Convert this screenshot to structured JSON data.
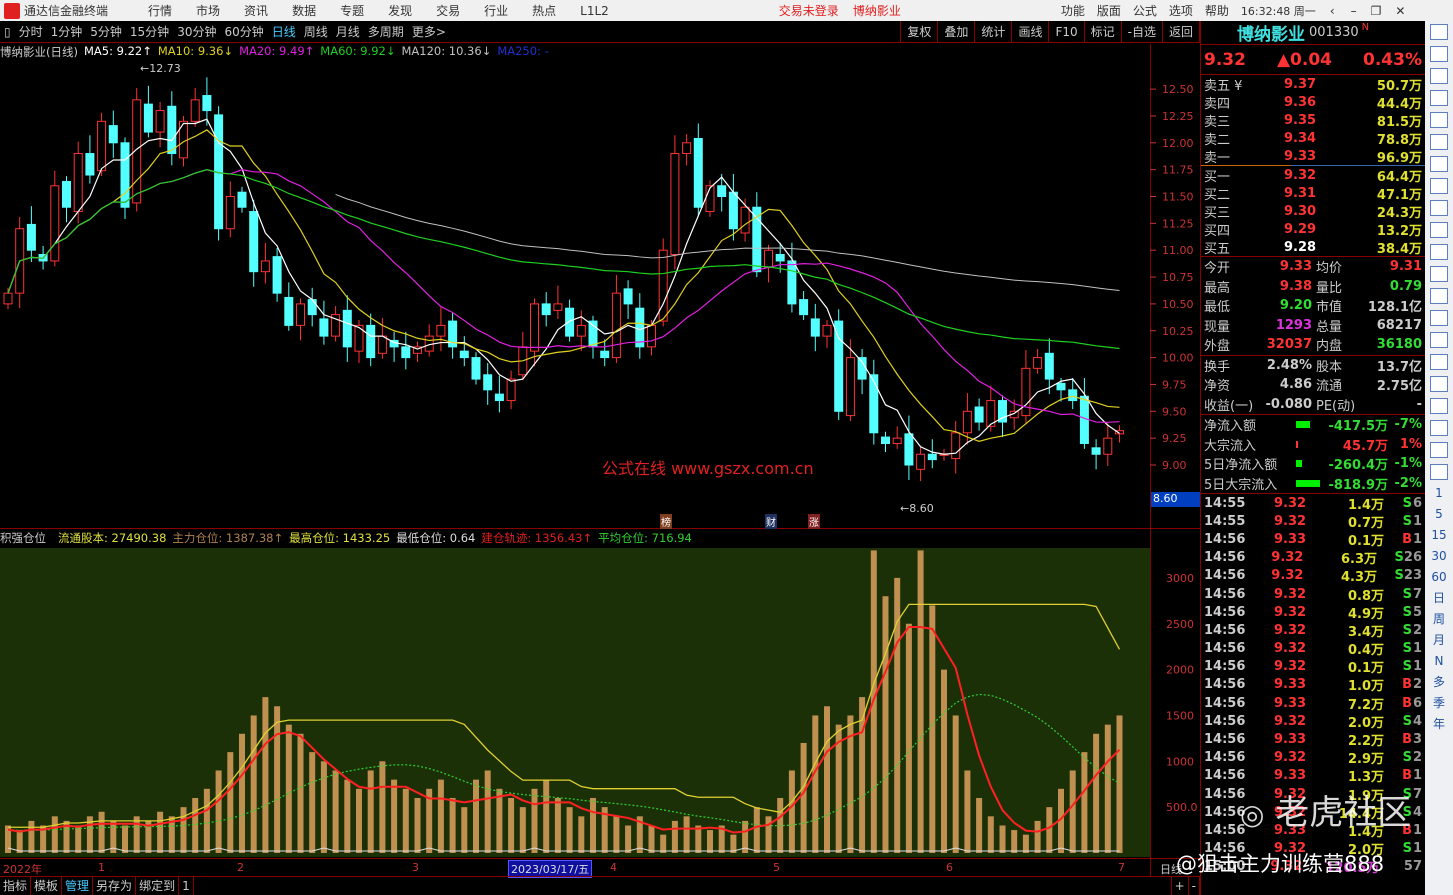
{
  "titlebar": {
    "app": "通达信金融终端",
    "menus": [
      "行情",
      "市场",
      "资讯",
      "数据",
      "专题",
      "发现",
      "交易",
      "行业",
      "热点",
      "L1L2"
    ],
    "login": "交易未登录",
    "stock": "博纳影业",
    "right_menus": [
      "功能",
      "版面",
      "公式",
      "选项",
      "帮助"
    ],
    "clock": "16:32:48 周一"
  },
  "toolbar": {
    "periods": [
      "分时",
      "1分钟",
      "5分钟",
      "15分钟",
      "30分钟",
      "60分钟",
      "日线",
      "周线",
      "月线",
      "多周期",
      "更多>"
    ],
    "selected": "日线",
    "tools": [
      "复权",
      "叠加",
      "统计",
      "画线",
      "F10",
      "标记",
      "-自选",
      "返回"
    ]
  },
  "ma": {
    "title": "博纳影业(日线)",
    "ma5": "MA5: 9.22↑",
    "ma10": "MA10: 9.36↓",
    "ma20": "MA20: 9.49↑",
    "ma60": "MA60: 9.92↓",
    "ma120": "MA120: 10.36↓",
    "ma250": "MA250: -"
  },
  "colors": {
    "up": "#ff3232",
    "down": "#54ffff",
    "ma5": "#ffffff",
    "ma10": "#e0d020",
    "ma20": "#e020e0",
    "ma60": "#20d020",
    "ma120": "#c0c0c0",
    "bar": "#c09050",
    "red_line": "#ff2020",
    "yellow_line": "#e0d030",
    "green_line": "#30d030"
  },
  "labels": {
    "high": "12.73",
    "low": "8.60",
    "cursor_price": "8.60",
    "markers": [
      "榜",
      "财",
      "涨"
    ],
    "watermark1": "公式在线  www.gszx.com.cn",
    "watermark2": "老虎社区",
    "watermark3": "@狙击主力训练营888"
  },
  "chart_data": [
    {
      "type": "candlestick",
      "title": "博纳影业(日线)",
      "ylim": [
        8.5,
        12.9
      ],
      "yticks": [
        "12.50",
        "12.25",
        "12.00",
        "11.75",
        "11.50",
        "11.25",
        "11.00",
        "10.75",
        "10.50",
        "10.25",
        "10.00",
        "9.75",
        "9.50",
        "9.25",
        "9.00"
      ],
      "close": [
        10.6,
        11.2,
        11.0,
        10.9,
        11.6,
        11.4,
        11.9,
        11.7,
        12.2,
        12.0,
        11.4,
        12.4,
        12.1,
        12.3,
        11.9,
        12.2,
        12.4,
        12.3,
        11.2,
        11.5,
        11.4,
        10.8,
        10.9,
        10.6,
        10.3,
        10.5,
        10.4,
        10.2,
        10.4,
        10.1,
        10.3,
        10.0,
        10.2,
        10.1,
        10.0,
        10.1,
        10.2,
        10.3,
        10.1,
        10.0,
        9.8,
        9.7,
        9.6,
        9.8,
        10.1,
        10.5,
        10.4,
        10.5,
        10.2,
        10.3,
        10.1,
        10.0,
        10.6,
        10.5,
        10.1,
        10.3,
        11.0,
        11.9,
        12.0,
        11.4,
        11.6,
        11.5,
        11.2,
        11.4,
        10.8,
        11.0,
        10.9,
        10.5,
        10.4,
        10.2,
        10.3,
        9.5,
        10.0,
        9.8,
        9.3,
        9.2,
        9.25,
        9.0,
        9.1,
        9.05,
        9.1,
        9.3,
        9.5,
        9.4,
        9.6,
        9.4,
        9.5,
        9.9,
        10.0,
        9.8,
        9.7,
        9.6,
        9.2,
        9.1,
        9.25,
        9.32
      ]
    },
    {
      "type": "bar+line",
      "title": "积强仓位",
      "legend": {
        "name": "积强仓位",
        "float": "流通股本: 27490.38",
        "main": "主力仓位: 1387.38↑",
        "max": "最高仓位: 1433.25",
        "min": "最低仓位: 0.64",
        "build": "建仓轨迹: 1356.43↑",
        "avg": "平均仓位: 716.94"
      },
      "yticks": [
        "3000",
        "2500",
        "2000",
        "1500",
        "1000",
        "500.0"
      ],
      "ylim": [
        0,
        3300
      ],
      "bars": [
        300,
        250,
        350,
        300,
        400,
        350,
        300,
        400,
        450,
        350,
        300,
        400,
        350,
        450,
        400,
        500,
        600,
        700,
        900,
        1100,
        1300,
        1500,
        1700,
        1600,
        1400,
        1300,
        1100,
        1000,
        900,
        800,
        700,
        900,
        1000,
        800,
        700,
        600,
        700,
        800,
        600,
        500,
        800,
        900,
        700,
        600,
        500,
        700,
        800,
        600,
        500,
        400,
        600,
        500,
        400,
        300,
        400,
        300,
        200,
        350,
        400,
        300,
        250,
        300,
        200,
        350,
        500,
        400,
        600,
        900,
        1200,
        1500,
        1600,
        1400,
        1500,
        1700,
        3300,
        2800,
        3000,
        2500,
        3300,
        2700,
        2000,
        1500,
        900,
        600,
        400,
        300,
        250,
        200,
        350,
        500,
        700,
        900,
        1100,
        1300,
        1400,
        1500
      ]
    }
  ],
  "xaxis": {
    "labels": [
      "2022年",
      "1",
      "2",
      "3",
      "4",
      "5",
      "6",
      "7"
    ],
    "cursor": "2023/03/17/五",
    "right": "日线"
  },
  "bottom_tabs": [
    "指标",
    "模板",
    "管理",
    "另存为",
    "绑定到",
    "1"
  ],
  "quote": {
    "name": "博纳影业",
    "code": "001330",
    "flag": "N",
    "price": "9.32",
    "change": "▲0.04",
    "pct": "0.43%",
    "asks": [
      [
        "卖五 ¥",
        "9.37",
        "50.7万"
      ],
      [
        "卖四",
        "9.36",
        "44.4万"
      ],
      [
        "卖三",
        "9.35",
        "81.5万"
      ],
      [
        "卖二",
        "9.34",
        "78.8万"
      ],
      [
        "卖一",
        "9.33",
        "96.9万"
      ]
    ],
    "bids": [
      [
        "买一",
        "9.32",
        "64.4万"
      ],
      [
        "买二",
        "9.31",
        "47.1万"
      ],
      [
        "买三",
        "9.30",
        "24.3万"
      ],
      [
        "买四",
        "9.29",
        "13.2万"
      ],
      [
        "买五",
        "9.28",
        "38.4万"
      ]
    ],
    "stats": [
      [
        "今开",
        "9.33",
        "均价",
        "9.31"
      ],
      [
        "最高",
        "9.38",
        "量比",
        "0.79"
      ],
      [
        "最低",
        "9.20",
        "市值",
        "128.1亿"
      ],
      [
        "现量",
        "1293",
        "总量",
        "68217"
      ],
      [
        "外盘",
        "32037",
        "内盘",
        "36180"
      ]
    ],
    "fund": [
      [
        "换手",
        "2.48%",
        "股本",
        "13.7亿"
      ],
      [
        "净资",
        "4.86",
        "流通",
        "2.75亿"
      ],
      [
        "收益(一)",
        "-0.080",
        "PE(动)",
        "-"
      ]
    ],
    "flows": [
      [
        "净流入额",
        "-417.5万",
        "-7%"
      ],
      [
        "大宗流入",
        "45.7万",
        "1%"
      ],
      [
        "5日净流入额",
        "-260.4万",
        "-1%"
      ],
      [
        "5日大宗流入",
        "-818.9万",
        "-2%"
      ]
    ]
  },
  "ticks": [
    [
      "14:55",
      "9.32",
      "1.4万",
      "S",
      "6"
    ],
    [
      "14:55",
      "9.32",
      "0.7万",
      "S",
      "1"
    ],
    [
      "14:56",
      "9.33",
      "0.1万",
      "B",
      "1"
    ],
    [
      "14:56",
      "9.32",
      "6.3万",
      "S",
      "26"
    ],
    [
      "14:56",
      "9.32",
      "4.3万",
      "S",
      "23"
    ],
    [
      "14:56",
      "9.32",
      "0.8万",
      "S",
      "7"
    ],
    [
      "14:56",
      "9.32",
      "4.9万",
      "S",
      "5"
    ],
    [
      "14:56",
      "9.32",
      "3.4万",
      "S",
      "2"
    ],
    [
      "14:56",
      "9.32",
      "0.4万",
      "S",
      "1"
    ],
    [
      "14:56",
      "9.32",
      "0.1万",
      "S",
      "1"
    ],
    [
      "14:56",
      "9.33",
      "1.0万",
      "B",
      "2"
    ],
    [
      "14:56",
      "9.33",
      "7.2万",
      "B",
      "6"
    ],
    [
      "14:56",
      "9.32",
      "2.0万",
      "S",
      "4"
    ],
    [
      "14:56",
      "9.33",
      "2.2万",
      "B",
      "3"
    ],
    [
      "14:56",
      "9.32",
      "2.9万",
      "S",
      "2"
    ],
    [
      "14:56",
      "9.33",
      "1.3万",
      "B",
      "1"
    ],
    [
      "14:56",
      "9.32",
      "1.9万",
      "S",
      "7"
    ],
    [
      "14:56",
      "9.32",
      "14.4万",
      "S",
      "4"
    ],
    [
      "14:56",
      "9.33",
      "1.4万",
      "B",
      "1"
    ],
    [
      "14:56",
      "9.32",
      "2.0万",
      "S",
      "1"
    ],
    [
      "15:00",
      "9.32",
      "120.5万",
      "",
      "57"
    ]
  ],
  "strip": [
    "1",
    "5",
    "15",
    "30",
    "60",
    "日",
    "周",
    "月",
    "N",
    "多",
    "季",
    "年"
  ]
}
